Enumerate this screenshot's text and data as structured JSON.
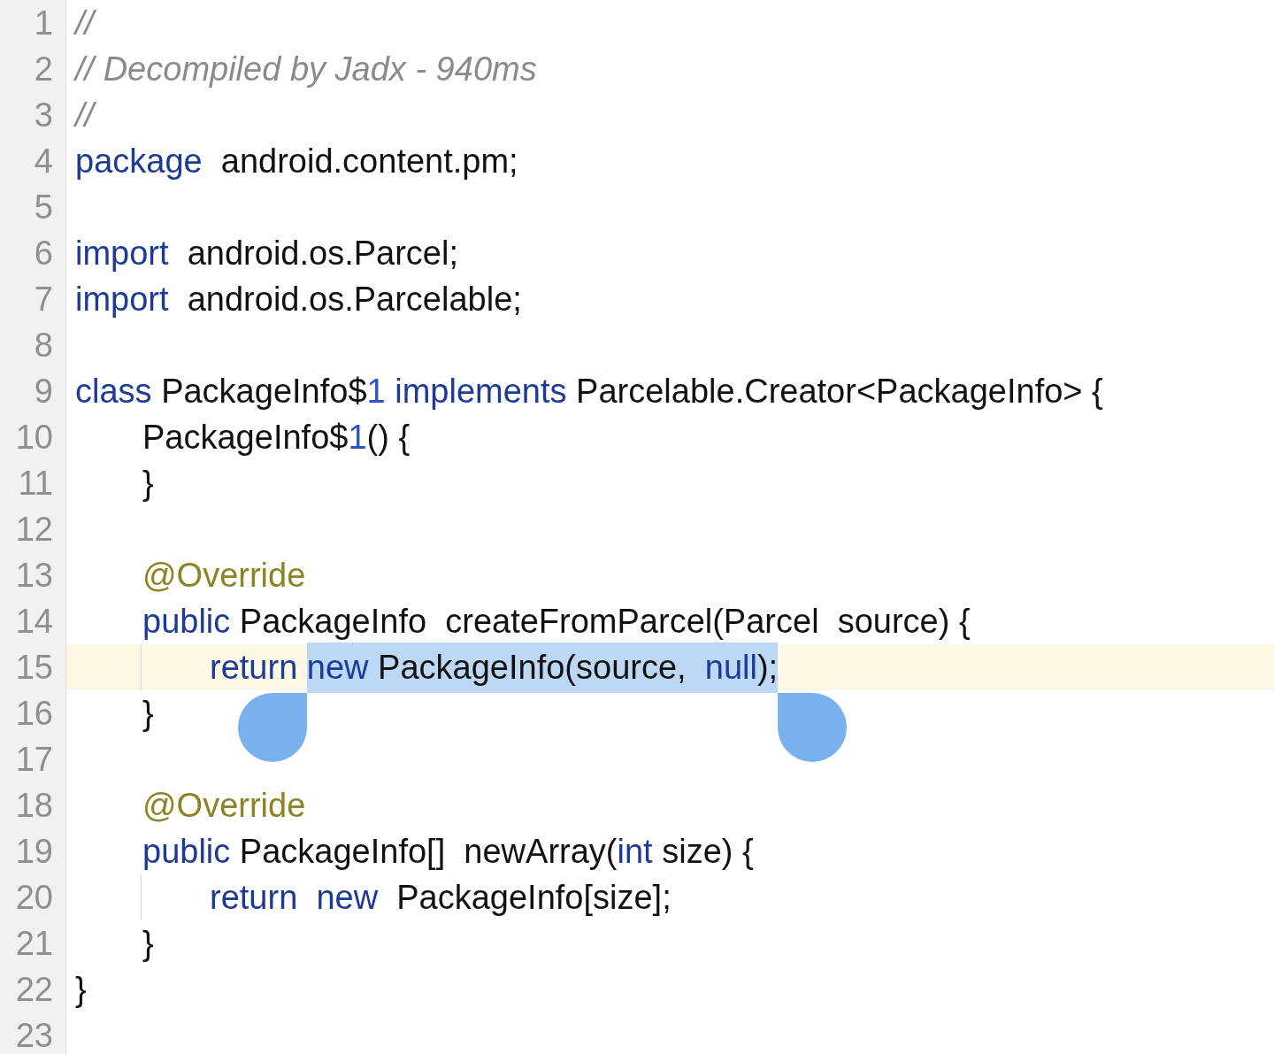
{
  "lines": [
    {
      "number": "1",
      "current": false,
      "guide": false,
      "tokens": [
        {
          "text": "//",
          "kind": "comment",
          "selected": false
        }
      ]
    },
    {
      "number": "2",
      "current": false,
      "guide": false,
      "tokens": [
        {
          "text": "// Decompiled by Jadx - 940ms",
          "kind": "comment",
          "selected": false
        }
      ]
    },
    {
      "number": "3",
      "current": false,
      "guide": false,
      "tokens": [
        {
          "text": "//",
          "kind": "comment",
          "selected": false
        }
      ]
    },
    {
      "number": "4",
      "current": false,
      "guide": false,
      "tokens": [
        {
          "text": "package",
          "kind": "keyword",
          "selected": false
        },
        {
          "text": "  android.content.pm;",
          "kind": "plain",
          "selected": false
        }
      ]
    },
    {
      "number": "5",
      "current": false,
      "guide": false
    },
    {
      "number": "6",
      "current": false,
      "guide": false,
      "tokens": [
        {
          "text": "import",
          "kind": "keyword",
          "selected": false
        },
        {
          "text": "  android.os.Parcel;",
          "kind": "plain",
          "selected": false
        }
      ]
    },
    {
      "number": "7",
      "current": false,
      "guide": false,
      "tokens": [
        {
          "text": "import",
          "kind": "keyword",
          "selected": false
        },
        {
          "text": "  android.os.Parcelable;",
          "kind": "plain",
          "selected": false
        }
      ]
    },
    {
      "number": "8",
      "current": false,
      "guide": false
    },
    {
      "number": "9",
      "current": false,
      "guide": false,
      "tokens": [
        {
          "text": "class",
          "kind": "keyword",
          "selected": false
        },
        {
          "text": " PackageInfo$",
          "kind": "plain",
          "selected": false
        },
        {
          "text": "1",
          "kind": "number",
          "selected": false
        },
        {
          "text": " implements",
          "kind": "keyword",
          "selected": false
        },
        {
          "text": " Parcelable.Creator<PackageInfo> {",
          "kind": "plain",
          "selected": false
        }
      ]
    },
    {
      "number": "10",
      "current": false,
      "guide": false,
      "tokens": [
        {
          "text": "\tPackageInfo$",
          "kind": "plain",
          "selected": false
        },
        {
          "text": "1",
          "kind": "number",
          "selected": false
        },
        {
          "text": "() {",
          "kind": "plain",
          "selected": false
        }
      ]
    },
    {
      "number": "11",
      "current": false,
      "guide": false,
      "tokens": [
        {
          "text": "\t}",
          "kind": "plain",
          "selected": false
        }
      ]
    },
    {
      "number": "12",
      "current": false,
      "guide": false
    },
    {
      "number": "13",
      "current": false,
      "guide": false,
      "tokens": [
        {
          "text": "\t@Override",
          "kind": "annotation",
          "selected": false
        }
      ]
    },
    {
      "number": "14",
      "current": false,
      "guide": false,
      "tokens": [
        {
          "text": "\tpublic",
          "kind": "keyword",
          "selected": false
        },
        {
          "text": " PackageInfo  createFromParcel(Parcel  source) {",
          "kind": "plain",
          "selected": false
        }
      ]
    },
    {
      "number": "15",
      "current": true,
      "guide": true,
      "tokens": [
        {
          "text": "\t\treturn ",
          "kind": "keyword",
          "selected": false
        },
        {
          "text": "new",
          "kind": "keyword",
          "selected": true
        },
        {
          "text": " PackageInfo(source,  ",
          "kind": "plain",
          "selected": true
        },
        {
          "text": "null",
          "kind": "keyword",
          "selected": true
        },
        {
          "text": ");",
          "kind": "plain",
          "selected": true
        }
      ]
    },
    {
      "number": "16",
      "current": false,
      "guide": false,
      "tokens": [
        {
          "text": "\t}",
          "kind": "plain",
          "selected": false
        }
      ]
    },
    {
      "number": "17",
      "current": false,
      "guide": false
    },
    {
      "number": "18",
      "current": false,
      "guide": false,
      "tokens": [
        {
          "text": "\t@Override",
          "kind": "annotation",
          "selected": false
        }
      ]
    },
    {
      "number": "19",
      "current": false,
      "guide": false,
      "tokens": [
        {
          "text": "\tpublic",
          "kind": "keyword",
          "selected": false
        },
        {
          "text": " PackageInfo[]  newArray(",
          "kind": "plain",
          "selected": false
        },
        {
          "text": "int",
          "kind": "keyword",
          "selected": false
        },
        {
          "text": " size) {",
          "kind": "plain",
          "selected": false
        }
      ]
    },
    {
      "number": "20",
      "current": false,
      "guide": true,
      "tokens": [
        {
          "text": "\t\treturn  new",
          "kind": "keyword",
          "selected": false
        },
        {
          "text": "  PackageInfo[size];",
          "kind": "plain",
          "selected": false
        }
      ]
    },
    {
      "number": "21",
      "current": false,
      "guide": false,
      "tokens": [
        {
          "text": "\t}",
          "kind": "plain",
          "selected": false
        }
      ]
    },
    {
      "number": "22",
      "current": false,
      "guide": false,
      "tokens": [
        {
          "text": "}",
          "kind": "plain",
          "selected": false
        }
      ]
    },
    {
      "number": "23",
      "current": false,
      "guide": false
    }
  ]
}
